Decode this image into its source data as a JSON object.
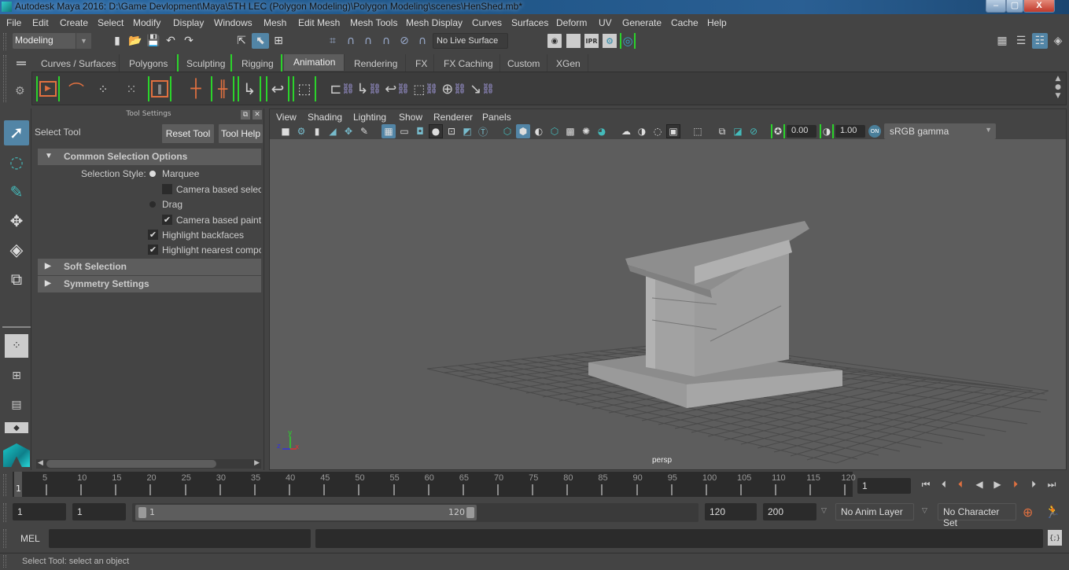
{
  "window": {
    "title": "Autodesk Maya 2016: D:\\Game Devlopment\\Maya\\5TH LEC (Polygon Modeling)\\Polygon Modeling\\scenes\\HenShed.mb*",
    "controls": {
      "minimize": "–",
      "maximize": "▢",
      "close": "X"
    }
  },
  "menubar": [
    "File",
    "Edit",
    "Create",
    "Select",
    "Modify",
    "Display",
    "Windows",
    "Mesh",
    "Edit Mesh",
    "Mesh Tools",
    "Mesh Display",
    "Curves",
    "Surfaces",
    "Deform",
    "UV",
    "Generate",
    "Cache",
    "Help"
  ],
  "statusline": {
    "mode": "Modeling",
    "live_surface": "No Live Surface",
    "render_icons": [
      "render-view-icon",
      "render-frame-icon",
      "ipr-icon",
      "render-settings-icon",
      "hypershade-icon"
    ],
    "ipr_label": "IPR"
  },
  "shelf": {
    "tabs": [
      "Curves / Surfaces",
      "Polygons",
      "Sculpting",
      "Rigging",
      "Animation",
      "Rendering",
      "FX",
      "FX Caching",
      "Custom",
      "XGen"
    ],
    "active_tab": "Animation",
    "icons": [
      "playblast-icon",
      "motion-trail-icon",
      "ghost-icon",
      "unghost-icon",
      "create-clip-icon",
      "set-key-icon",
      "set-breakdown-icon",
      "set-driven-key-icon",
      "key-translate-icon",
      "key-rotate-icon",
      "key-scale-icon",
      "parent-constraint-icon",
      "point-constraint-icon",
      "orient-constraint-icon",
      "scale-constraint-icon",
      "aim-constraint-icon",
      "pole-vector-constraint-icon"
    ]
  },
  "tool_settings": {
    "panel_title": "Tool Settings",
    "tool_name": "Select Tool",
    "reset_button": "Reset Tool",
    "help_button": "Tool Help",
    "sections": [
      {
        "label": "Common Selection Options",
        "expanded": true
      },
      {
        "label": "Soft Selection",
        "expanded": false
      },
      {
        "label": "Symmetry Settings",
        "expanded": false
      }
    ],
    "selection_style_label": "Selection Style:",
    "options": {
      "marquee": {
        "label": "Marquee",
        "selected": true
      },
      "camera_based_selection": {
        "label": "Camera based selecti",
        "checked": false
      },
      "drag": {
        "label": "Drag",
        "selected": false
      },
      "camera_based_paint": {
        "label": "Camera based paint s",
        "checked": true
      },
      "highlight_backfaces": {
        "label": "Highlight backfaces",
        "checked": true
      },
      "highlight_nearest": {
        "label": "Highlight nearest compo",
        "checked": true
      }
    }
  },
  "viewport": {
    "menu": [
      "View",
      "Shading",
      "Lighting",
      "Show",
      "Renderer",
      "Panels"
    ],
    "exposure": "0.00",
    "gamma": "1.00",
    "color_mgmt_toggle": "ON",
    "view_transform": "sRGB gamma",
    "camera_label": "persp",
    "axis_labels": {
      "x": "x",
      "y": "y",
      "z": "z"
    }
  },
  "timeline": {
    "start_marker": "1",
    "ticks": [
      "5",
      "10",
      "15",
      "20",
      "25",
      "30",
      "35",
      "40",
      "45",
      "50",
      "55",
      "60",
      "65",
      "70",
      "75",
      "80",
      "85",
      "90",
      "95",
      "100",
      "105",
      "110",
      "115",
      "120"
    ],
    "current_frame": "1"
  },
  "range": {
    "start": "1",
    "playback_start": "1",
    "slider_start": "1",
    "slider_end": "120",
    "playback_end": "120",
    "end": "200",
    "anim_layer": "No Anim Layer",
    "character_set": "No Character Set"
  },
  "command_line": {
    "language": "MEL",
    "input": "",
    "output": ""
  },
  "status_message": "Select Tool: select an object",
  "colors": {
    "accent_blue": "#5285a6",
    "shelf_green": "#2bd32b",
    "key_orange": "#e07040",
    "viewport_bg": "#5d5d5d"
  }
}
